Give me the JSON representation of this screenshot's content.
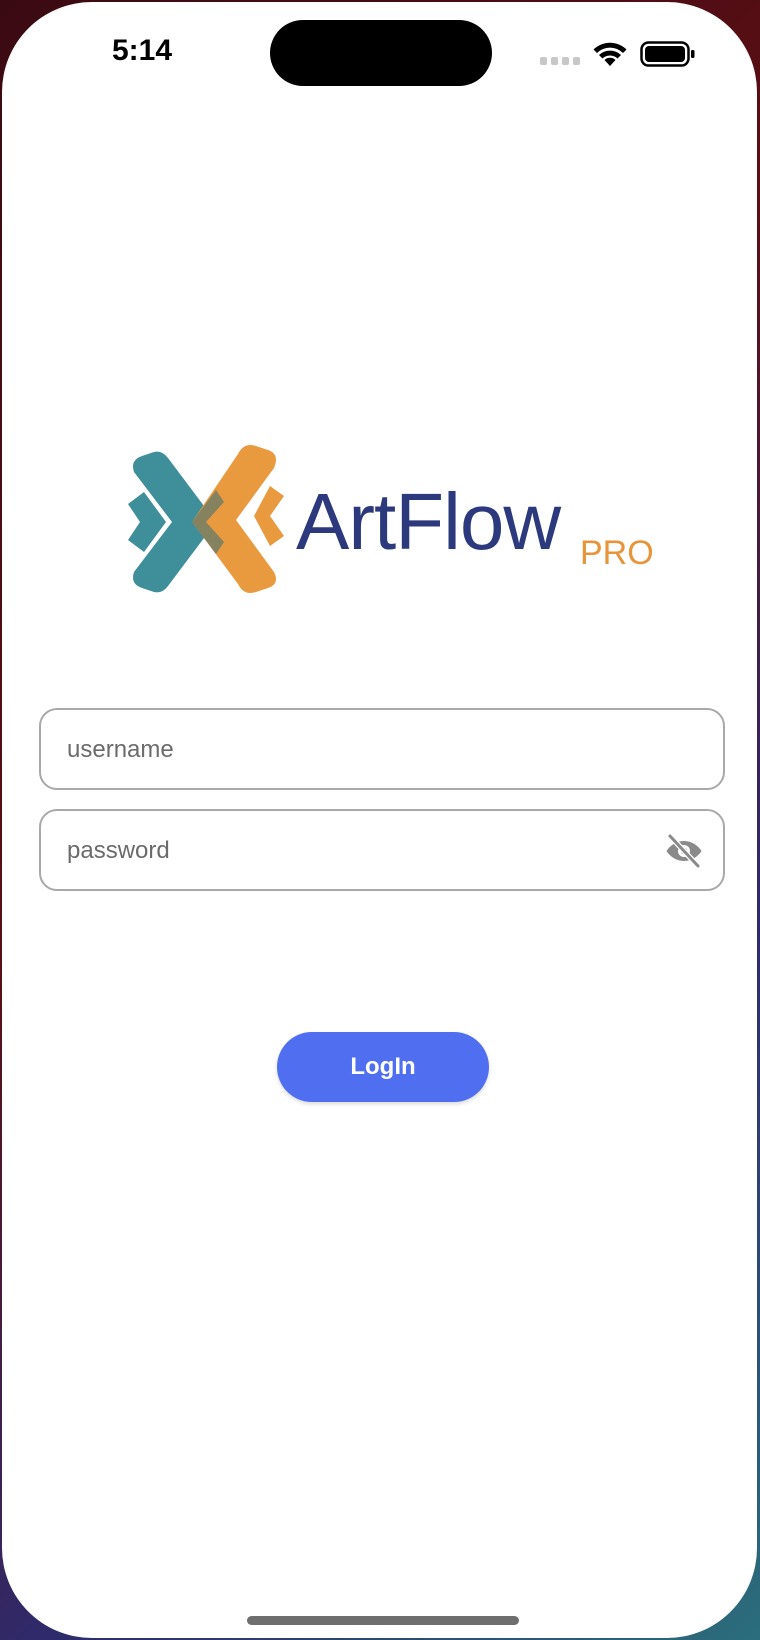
{
  "status_bar": {
    "time": "5:14"
  },
  "logo": {
    "name": "ArtFlow",
    "suffix": "PRO",
    "colors": {
      "teal": "#3f8f9b",
      "orange": "#ea9a3e",
      "navy": "#2c3a7d"
    }
  },
  "form": {
    "username": {
      "placeholder": "username",
      "value": ""
    },
    "password": {
      "placeholder": "password",
      "value": "",
      "visibility_icon": "eye-off-icon"
    },
    "login_label": "LogIn"
  },
  "colors": {
    "accent": "#4f6ff0",
    "field_border": "#a9a9a9",
    "placeholder": "#6b6b6b"
  }
}
